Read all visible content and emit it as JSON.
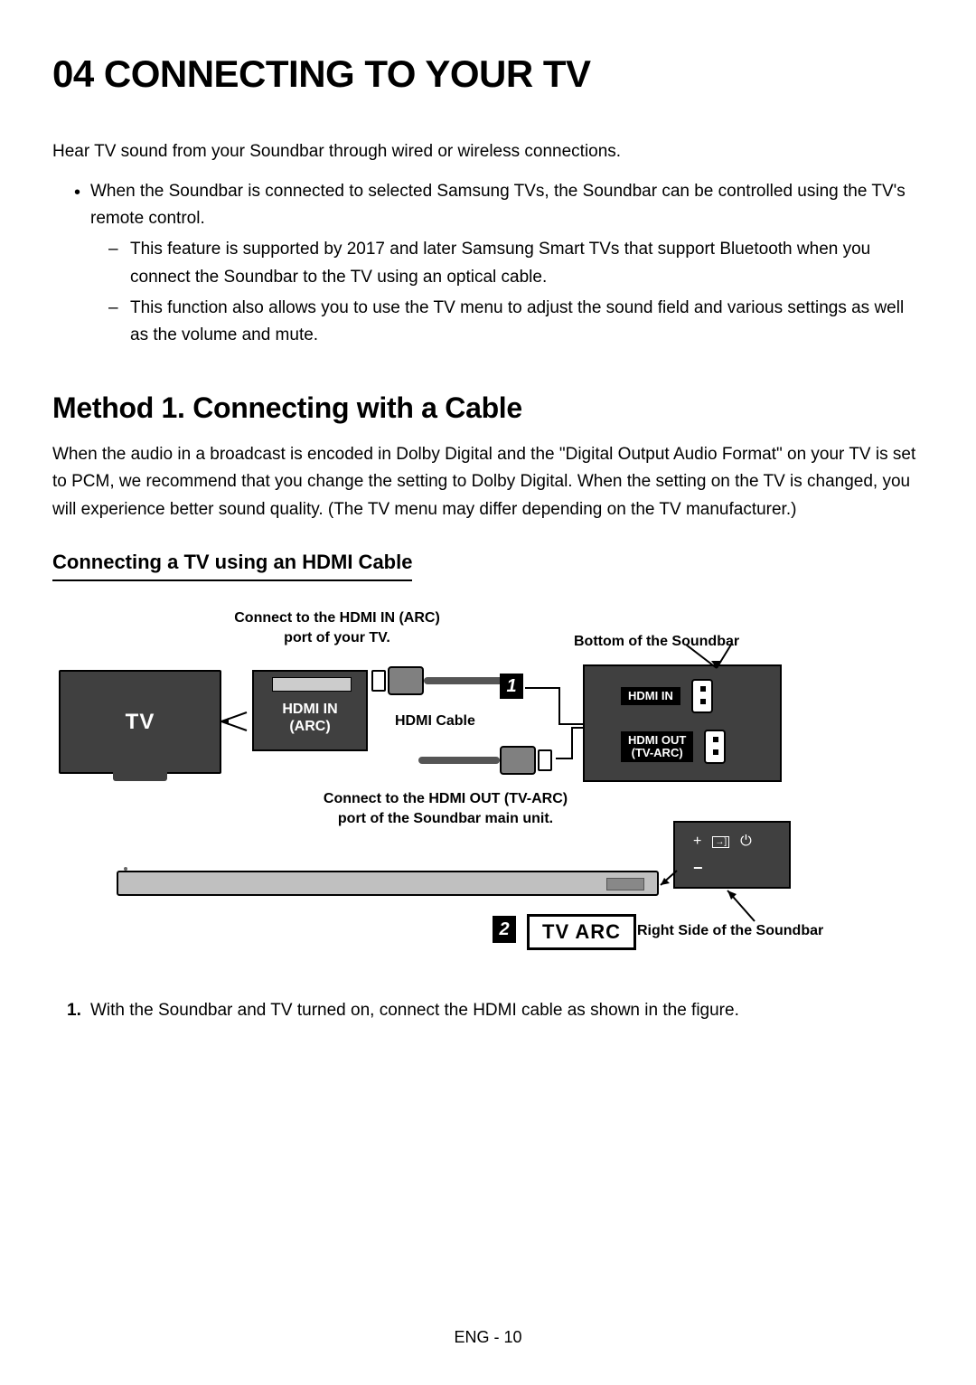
{
  "heading": "04   CONNECTING TO YOUR TV",
  "intro": "Hear TV sound from your Soundbar through wired or wireless connections.",
  "bullet1": "When the Soundbar is connected to selected Samsung TVs, the Soundbar can be controlled using the TV's remote control.",
  "sub1": "This feature is supported by 2017 and later Samsung Smart TVs that support Bluetooth when you connect the Soundbar to the TV using an optical cable.",
  "sub2": "This function also allows you to use the TV menu to adjust the sound field and various settings as well as the volume and mute.",
  "method_heading": "Method 1. Connecting with a Cable",
  "method_text": "When the audio in a broadcast is encoded in Dolby Digital and the \"Digital Output Audio Format\" on your TV is set to PCM, we recommend that you change the setting to Dolby Digital. When the setting on the TV is changed, you will experience better sound quality. (The TV menu may differ depending on the TV manufacturer.)",
  "hdmi_heading": "Connecting a TV using an HDMI Cable",
  "diagram": {
    "connect_tv_label": "Connect to the HDMI IN (ARC) port of your TV.",
    "bottom_soundbar": "Bottom of the Soundbar",
    "tv": "TV",
    "hdmi_in_arc": "HDMI IN\n(ARC)",
    "hdmi_cable": "HDMI Cable",
    "step1": "1",
    "hdmi_in": "HDMI IN",
    "hdmi_out": "HDMI OUT\n(TV-ARC)",
    "connect_out_label": "Connect to the HDMI OUT (TV-ARC) port of the Soundbar main unit.",
    "step2": "2",
    "tv_arc": "TV ARC",
    "right_side": "Right Side of the Soundbar"
  },
  "step1_text": "With the Soundbar and TV turned on, connect the HDMI cable as shown in the figure.",
  "footer": "ENG - 10"
}
